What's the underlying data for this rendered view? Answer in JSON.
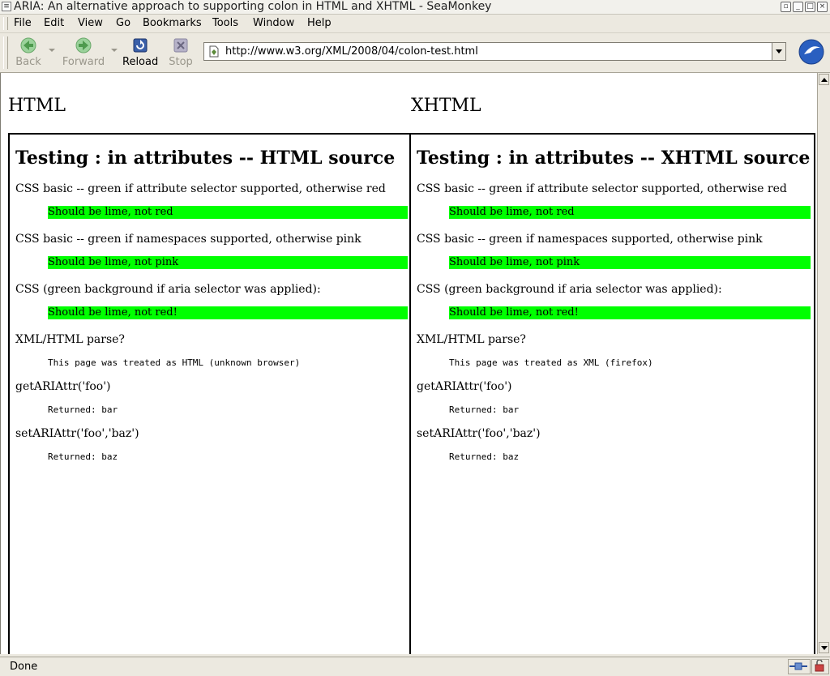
{
  "window": {
    "title": "ARIA: An alternative approach to supporting colon in HTML and XHTML - SeaMonkey"
  },
  "menubar": {
    "items": [
      {
        "label": "File"
      },
      {
        "label": "Edit"
      },
      {
        "label": "View"
      },
      {
        "label": "Go"
      },
      {
        "label": "Bookmarks"
      },
      {
        "label": "Tools"
      },
      {
        "label": "Window"
      },
      {
        "label": "Help"
      }
    ]
  },
  "toolbar": {
    "back_label": "Back",
    "forward_label": "Forward",
    "reload_label": "Reload",
    "stop_label": "Stop",
    "url": "http://www.w3.org/XML/2008/04/colon-test.html"
  },
  "page": {
    "left_heading": "HTML",
    "right_heading": "XHTML",
    "left_frame": {
      "title": "Testing : in attributes -- HTML source",
      "line1": "CSS basic -- green if attribute selector supported, otherwise red",
      "box1": "Should be lime, not red",
      "line2": "CSS basic -- green if namespaces supported, otherwise pink",
      "box2": "Should be lime, not pink",
      "line3": "CSS (green background if aria selector was applied):",
      "box3": "Should be lime, not red!",
      "line4": "XML/HTML parse?",
      "result4": "This page was treated as HTML (unknown browser)",
      "line5": "getARIAttr('foo')",
      "result5": "Returned: bar",
      "line6": "setARIAttr('foo','baz')",
      "result6": "Returned: baz"
    },
    "right_frame": {
      "title": "Testing : in attributes -- XHTML source",
      "line1": "CSS basic -- green if attribute selector supported, otherwise red",
      "box1": "Should be lime, not red",
      "line2": "CSS basic -- green if namespaces supported, otherwise pink",
      "box2": "Should be lime, not pink",
      "line3": "CSS (green background if aria selector was applied):",
      "box3": "Should be lime, not red!",
      "line4": "XML/HTML parse?",
      "result4": "This page was treated as XML (firefox)",
      "line5": "getARIAttr('foo')",
      "result5": "Returned: bar",
      "line6": "setARIAttr('foo','baz')",
      "result6": "Returned: baz"
    }
  },
  "statusbar": {
    "text": "Done"
  },
  "colors": {
    "lime": "#00ff00",
    "chrome": "#ece9e0"
  }
}
